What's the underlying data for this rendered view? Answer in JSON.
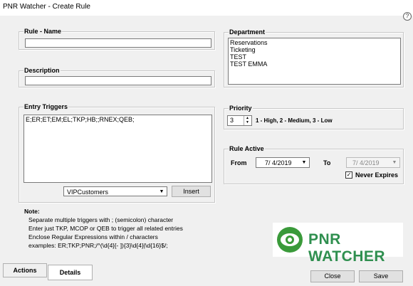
{
  "window": {
    "title": "PNR Watcher - Create Rule",
    "help": "?"
  },
  "rule_name": {
    "label": "Rule - Name",
    "value": ""
  },
  "description": {
    "label": "Description",
    "value": ""
  },
  "entry_triggers": {
    "label": "Entry Triggers",
    "value": "E;ER;ET;EM;EL;TKP;HB;;RNEX;QEB;",
    "dropdown_value": "VIPCustomers",
    "insert_label": "Insert"
  },
  "note": {
    "label": "Note:",
    "lines": [
      "Separate multiple triggers with ; (semicolon) character",
      "Enter just TKP, MCOP or QEB to trigger all related entries",
      "Enclose Regular Expressions within / characters",
      "examples: ER;TKP;PNR;/^(\\d{4}[- ]){3}\\d{4}|\\d{16}$/;"
    ]
  },
  "department": {
    "label": "Department",
    "items": [
      "Reservations",
      "Ticketing",
      "TEST",
      "TEST EMMA"
    ]
  },
  "priority": {
    "label": "Priority",
    "value": "3",
    "hint": "1 - High, 2 - Medium, 3 - Low"
  },
  "rule_active": {
    "label": "Rule Active",
    "from_label": "From",
    "from_value": "7/ 4/2019",
    "to_label": "To",
    "to_value": "7/ 4/2019",
    "never_expires_label": "Never Expires",
    "never_expires_checked": true
  },
  "logo": {
    "text": "PNR WATCHER"
  },
  "tabs": [
    {
      "label": "Actions"
    },
    {
      "label": "Details"
    }
  ],
  "buttons": {
    "close": "Close",
    "save": "Save"
  },
  "colors": {
    "logo_green": "#3a9a3a",
    "logo_text": "#2f8f4f"
  }
}
